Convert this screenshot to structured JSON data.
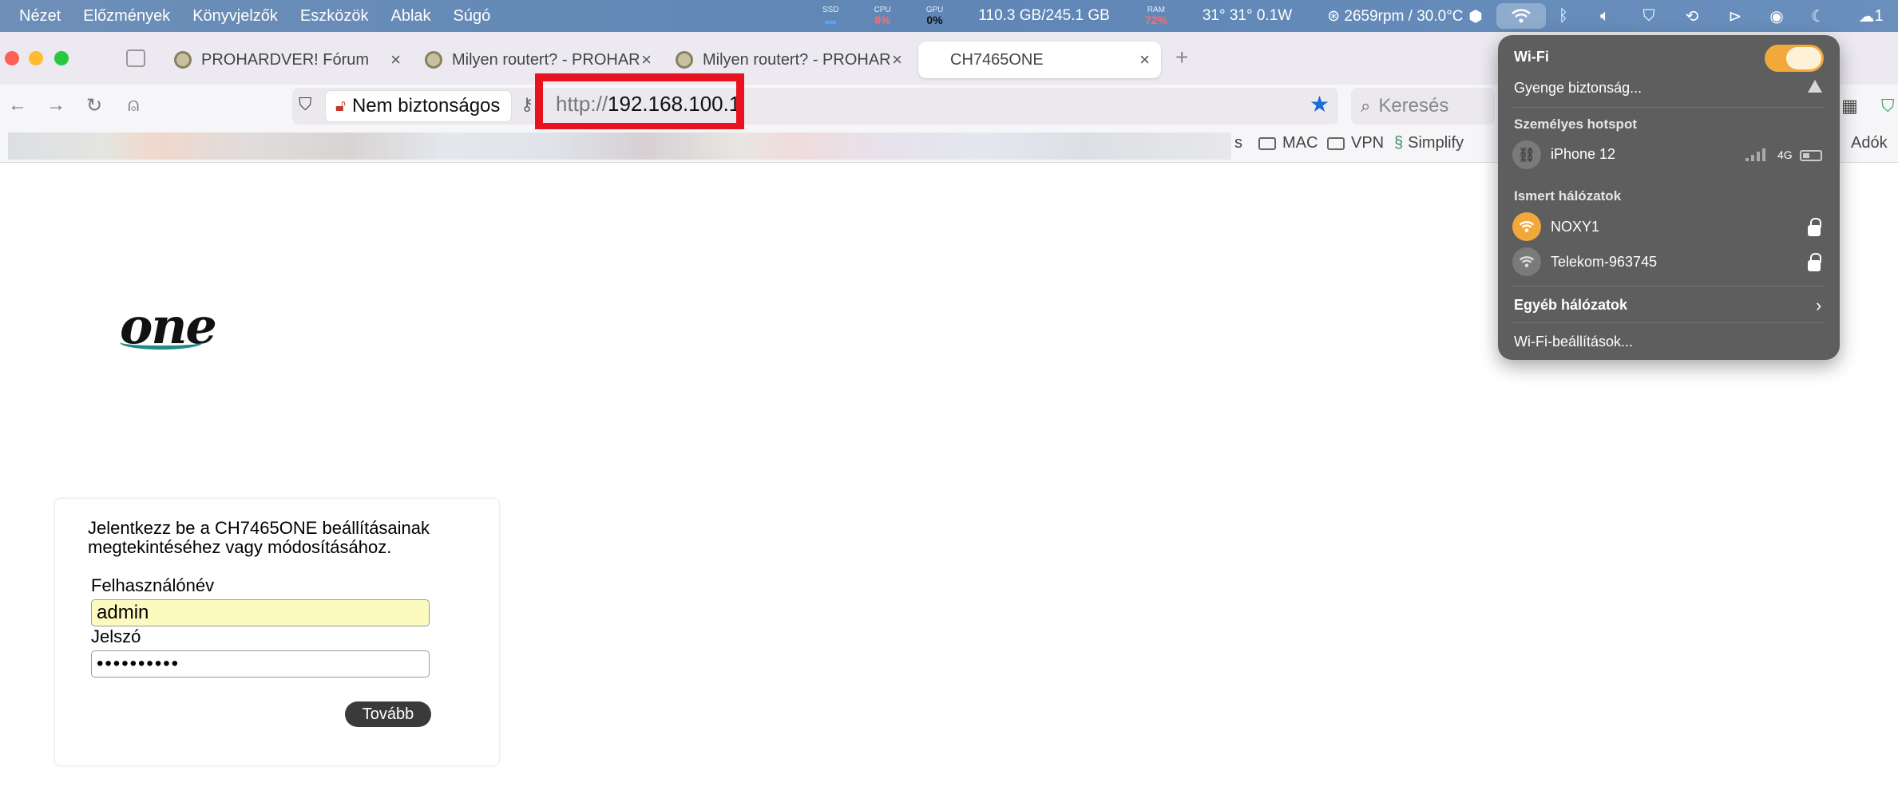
{
  "menubar": {
    "items": [
      "Nézet",
      "Előzmények",
      "Könyvjelzők",
      "Eszközök",
      "Ablak",
      "Súgó"
    ],
    "ssd_label": "SSD",
    "cpu_label": "CPU",
    "cpu_value": "8%",
    "gpu_label": "GPU",
    "gpu_value": "0%",
    "disk": "110.3 GB/245.1 GB",
    "ram_label": "RAM",
    "ram_value": "72%",
    "temps": "31° 31° 0.1W",
    "fan": "2659rpm / 30.0°C",
    "trailing": "1"
  },
  "tabs": [
    {
      "title": "PROHARDVER! Fórum",
      "close": "×"
    },
    {
      "title": "Milyen routert? - PROHAR",
      "close": "×"
    },
    {
      "title": "Milyen routert? - PROHAR",
      "close": "×"
    },
    {
      "title": "CH7465ONE",
      "close": "×"
    }
  ],
  "newtab": "+",
  "address": {
    "security_label": "Nem biztonságos",
    "protocol": "http://",
    "host": "192.168.100.1",
    "search_placeholder": "Keresés"
  },
  "bookmarks": {
    "partial": "s",
    "items": [
      "MAC",
      "VPN",
      "Simplify"
    ],
    "right": "Adók"
  },
  "page": {
    "logo": "one",
    "intro": "Jelentkezz be a CH7465ONE beállításainak megtekintéséhez vagy módosításához.",
    "username_label": "Felhasználónév",
    "username_value": "admin",
    "password_label": "Jelszó",
    "password_mask": "••••••••••",
    "next_button": "Tovább"
  },
  "wifi": {
    "title": "Wi-Fi",
    "enabled": true,
    "current": "Gyenge biztonság...",
    "hotspot_header": "Személyes hotspot",
    "hotspot_name": "iPhone 12",
    "hotspot_network": "4G",
    "known_header": "Ismert hálózatok",
    "known": [
      {
        "name": "NOXY1",
        "connected": true,
        "locked": true
      },
      {
        "name": "Telekom-963745",
        "connected": false,
        "locked": true
      }
    ],
    "other": "Egyéb hálózatok",
    "settings": "Wi-Fi-beállítások..."
  },
  "colors": {
    "url_highlight": "#e8131f",
    "wifi_accent": "#f2a93b",
    "menubar": "#5f86b5"
  }
}
